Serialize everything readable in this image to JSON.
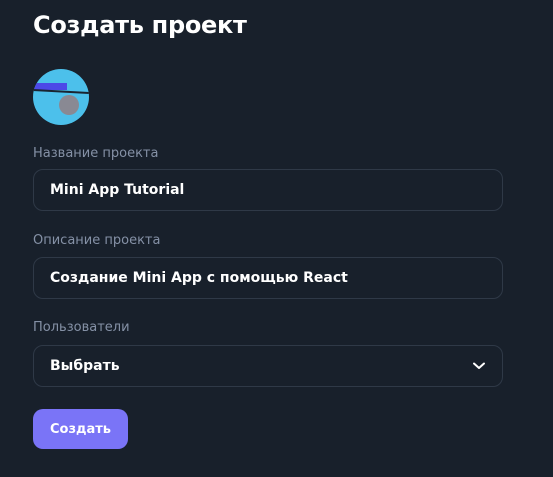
{
  "header": {
    "title": "Создать проект"
  },
  "project_icon": {
    "icon": "project-avatar-icon",
    "colors": {
      "background": "#4cc0eb",
      "bar": "#4c49e7",
      "line": "#1a2430",
      "circle": "#898993"
    }
  },
  "form": {
    "name": {
      "label": "Название проекта",
      "value": "Mini App Tutorial"
    },
    "description": {
      "label": "Описание проекта",
      "value": "Создание Mini App с помощью React"
    },
    "users": {
      "label": "Пользователи",
      "selected": "Выбрать",
      "icon": "chevron-down-icon"
    }
  },
  "actions": {
    "create_label": "Создать",
    "accent_color": "#7a74f7"
  }
}
